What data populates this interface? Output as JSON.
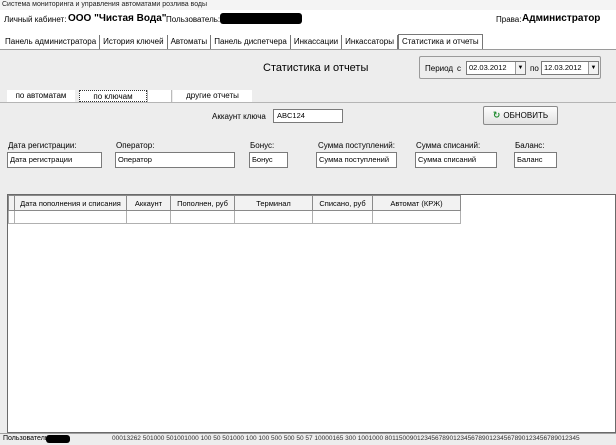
{
  "window": {
    "title": "Система мониторинга и управления автоматами розлива воды"
  },
  "header": {
    "cabinet_label": "Личный кабинет:",
    "cabinet_name": "ООО \"Чистая Вода\"",
    "user_label": "Пользователь:",
    "rights_label": "Права:",
    "rights_value": "Администратор"
  },
  "tabs": [
    {
      "label": "Панель администратора"
    },
    {
      "label": "История ключей"
    },
    {
      "label": "Автоматы"
    },
    {
      "label": "Панель диспетчера"
    },
    {
      "label": "Инкассации"
    },
    {
      "label": "Инкассаторы"
    },
    {
      "label": "Статистика и отчеты"
    }
  ],
  "main": {
    "title": "Статистика и отчеты",
    "period_label": "Период",
    "from_label": "с",
    "to_label": "по",
    "date_from": "02.03.2012",
    "date_to": "12.03.2012",
    "subtabs": {
      "by_machines": "по автоматам",
      "by_keys": "по ключам",
      "other": "другие отчеты"
    },
    "key_account_label": "Аккаунт ключа",
    "key_account_value": "ABC124",
    "refresh_label": "ОБНОВИТЬ",
    "fields": [
      {
        "label": "Дата регистрации:",
        "value": "Дата регистрации"
      },
      {
        "label": "Оператор:",
        "value": "Оператор"
      },
      {
        "label": "Бонус:",
        "value": "Бонус"
      },
      {
        "label": "Сумма поступлений:",
        "value": "Сумма поступлений"
      },
      {
        "label": "Сумма списаний:",
        "value": "Сумма списаний"
      },
      {
        "label": "Баланс:",
        "value": "Баланс"
      }
    ],
    "grid_columns": [
      "Дата пополнения и списания",
      "Аккаунт",
      "Пополнен, руб",
      "Терминал",
      "Списано, руб",
      "Автомат (КРЖ)"
    ]
  },
  "status": {
    "label": "Пользователь:",
    "text": "00013262 501000 501001000 100 50 501000 100 100 500 500 50 57 10000165 300 1001000 801150090123456789012345678901234567890123456789012345"
  }
}
